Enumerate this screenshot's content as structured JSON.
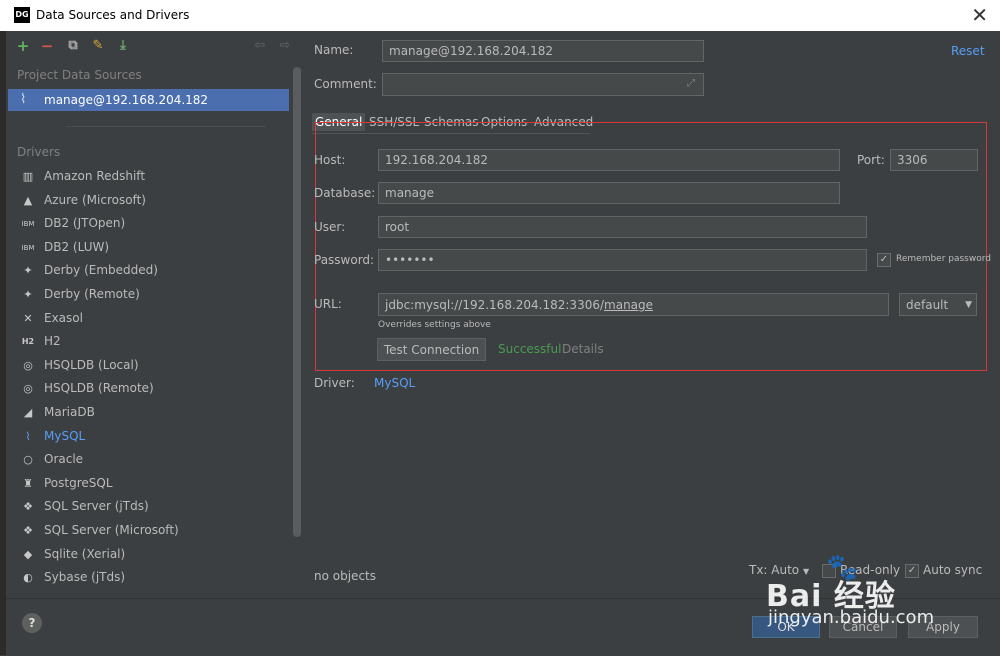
{
  "window": {
    "title": "Data Sources and Drivers",
    "app_badge": "DG",
    "close": "✕"
  },
  "sidebar": {
    "toolbar": {
      "add": "+",
      "remove": "−",
      "duplicate": "⧉",
      "edit": "✎",
      "import": "⤓",
      "back": "⇦",
      "forward": "⇨"
    },
    "project_label": "Project Data Sources",
    "selected_source": "manage@192.168.204.182",
    "drivers_label": "Drivers",
    "drivers": [
      {
        "label": "Amazon Redshift",
        "icon": "▥"
      },
      {
        "label": "Azure (Microsoft)",
        "icon": "▲"
      },
      {
        "label": "DB2 (JTOpen)",
        "icon": "IBM"
      },
      {
        "label": "DB2 (LUW)",
        "icon": "IBM"
      },
      {
        "label": "Derby (Embedded)",
        "icon": "✦"
      },
      {
        "label": "Derby (Remote)",
        "icon": "✦"
      },
      {
        "label": "Exasol",
        "icon": "✕"
      },
      {
        "label": "H2",
        "icon": "H2"
      },
      {
        "label": "HSQLDB (Local)",
        "icon": "◎"
      },
      {
        "label": "HSQLDB (Remote)",
        "icon": "◎"
      },
      {
        "label": "MariaDB",
        "icon": "◢"
      },
      {
        "label": "MySQL",
        "icon": "⌇"
      },
      {
        "label": "Oracle",
        "icon": "○"
      },
      {
        "label": "PostgreSQL",
        "icon": "♜"
      },
      {
        "label": "SQL Server (jTds)",
        "icon": "❖"
      },
      {
        "label": "SQL Server (Microsoft)",
        "icon": "❖"
      },
      {
        "label": "Sqlite (Xerial)",
        "icon": "◆"
      },
      {
        "label": "Sybase (jTds)",
        "icon": "◐"
      }
    ]
  },
  "form": {
    "name_label": "Name:",
    "name_value": "manage@192.168.204.182",
    "comment_label": "Comment:",
    "comment_value": "",
    "reset": "Reset",
    "tabs": [
      "General",
      "SSH/SSL",
      "Schemas",
      "Options",
      "Advanced"
    ],
    "host_label": "Host:",
    "host_value": "192.168.204.182",
    "port_label": "Port:",
    "port_value": "3306",
    "database_label": "Database:",
    "database_value": "manage",
    "user_label": "User:",
    "user_value": "root",
    "password_label": "Password:",
    "password_value": "•••••••",
    "remember_label": "Remember password",
    "url_label": "URL:",
    "url_prefix": "jdbc:mysql://192.168.204.182:3306/",
    "url_db": "manage",
    "url_mode": "default",
    "overrides_note": "Overrides settings above",
    "test_button": "Test Connection",
    "test_status": "Successful",
    "details": "Details",
    "driver_label": "Driver:",
    "driver_value": "MySQL",
    "objects_status": "no objects",
    "tx_label": "Tx: Auto",
    "readonly_label": "Read-only",
    "autosync_label": "Auto sync"
  },
  "footer": {
    "help": "?",
    "ok": "OK",
    "cancel": "Cancel",
    "apply": "Apply"
  },
  "watermark": {
    "brand": "Bai 经验",
    "url": "jingyan.baidu.com"
  },
  "colors": {
    "accent": "#589df6",
    "selection": "#4b6eaf",
    "success": "#499c54",
    "highlight_border": "#d43a3a"
  }
}
